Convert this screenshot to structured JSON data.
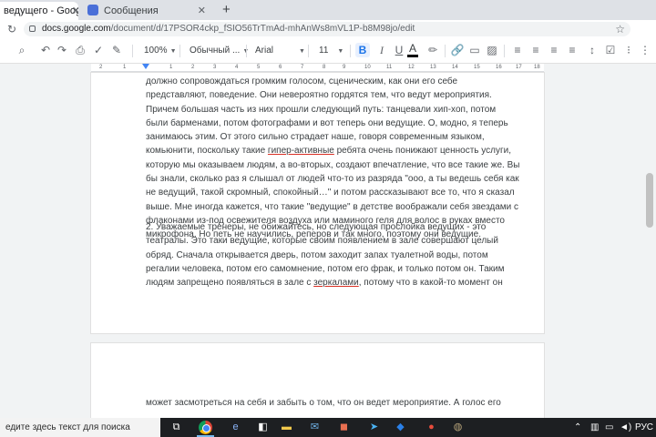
{
  "browser": {
    "tabs": [
      {
        "label": "ведущего - Google",
        "close": "✕"
      },
      {
        "label": "Сообщения",
        "close": "✕"
      }
    ],
    "new_tab": "+",
    "url_host": "docs.google.com",
    "url_path": "/document/d/17PSOR4ckp_fSIO56TrTmAd-mhAnWs8mVL1P-b8M98jo/edit"
  },
  "toolbar": {
    "zoom": "100%",
    "style": "Обычный ...",
    "font": "Arial",
    "size": "11",
    "bold": "B",
    "italic": "I",
    "underline": "U",
    "text_color": "A"
  },
  "ruler": {
    "numbers": [
      "2",
      "1",
      "1",
      "2",
      "3",
      "4",
      "5",
      "6",
      "7",
      "8",
      "9",
      "10",
      "11",
      "12",
      "13",
      "14",
      "15",
      "16",
      "17",
      "18"
    ]
  },
  "document": {
    "page1_para1": [
      "должно сопровождаться громким голосом, сценическим, как они его себе",
      "представляют, поведение. Они невероятно гордятся тем, что ведут мероприятия.",
      "Причем большая часть из них прошли следующий путь: танцевали хип-хоп, потом",
      "были барменами, потом фотографами и вот теперь они ведущие. О, модно, я теперь",
      "занимаюсь этим. От этого сильно страдает наше, говоря современным языком,",
      "комьюнити, поскольку такие ",
      "гипер-активные",
      " ребята очень понижают ценность услуги,",
      "которую мы оказываем людям, а во-вторых, создают впечатление, что все такие же. Вы",
      "бы знали, сколько раз я слышал от людей что-то из разряда \"ооо, а ты ведешь себя как",
      "не ведущий, такой скромный, спокойный…\" и потом рассказывают все то, что я сказал",
      "выше. Мне иногда кажется, что такие \"ведущие\" в детстве воображали себя звездами с",
      "флаконами из-под освежителя воздуха или маминого геля для волос в руках вместо",
      "микрофона. Но петь не научились, реперов и так много, поэтому они ведущие."
    ],
    "page1_para2": [
      "2. Уважаемые тренеры, не обижайтесь, но следующая прослойка ведущих - это",
      "театралы. Это таки ведущие, которые своим появлением в зале совершают целый",
      "обряд. Сначала открывается дверь, потом заходит запах туалетной воды, потом",
      "регалии человека, потом его самомнение, потом его фрак, и только потом он. Таким",
      "людям запрещено появляться в зале с ",
      "зеркалами",
      ", потому что в какой-то момент он"
    ],
    "page2_line": "может засмотреться на себя и забыть о том, что он ведет мероприятие. А голос его"
  },
  "taskbar": {
    "search_placeholder": "едите здесь текст для поиска",
    "language": "РУС"
  }
}
